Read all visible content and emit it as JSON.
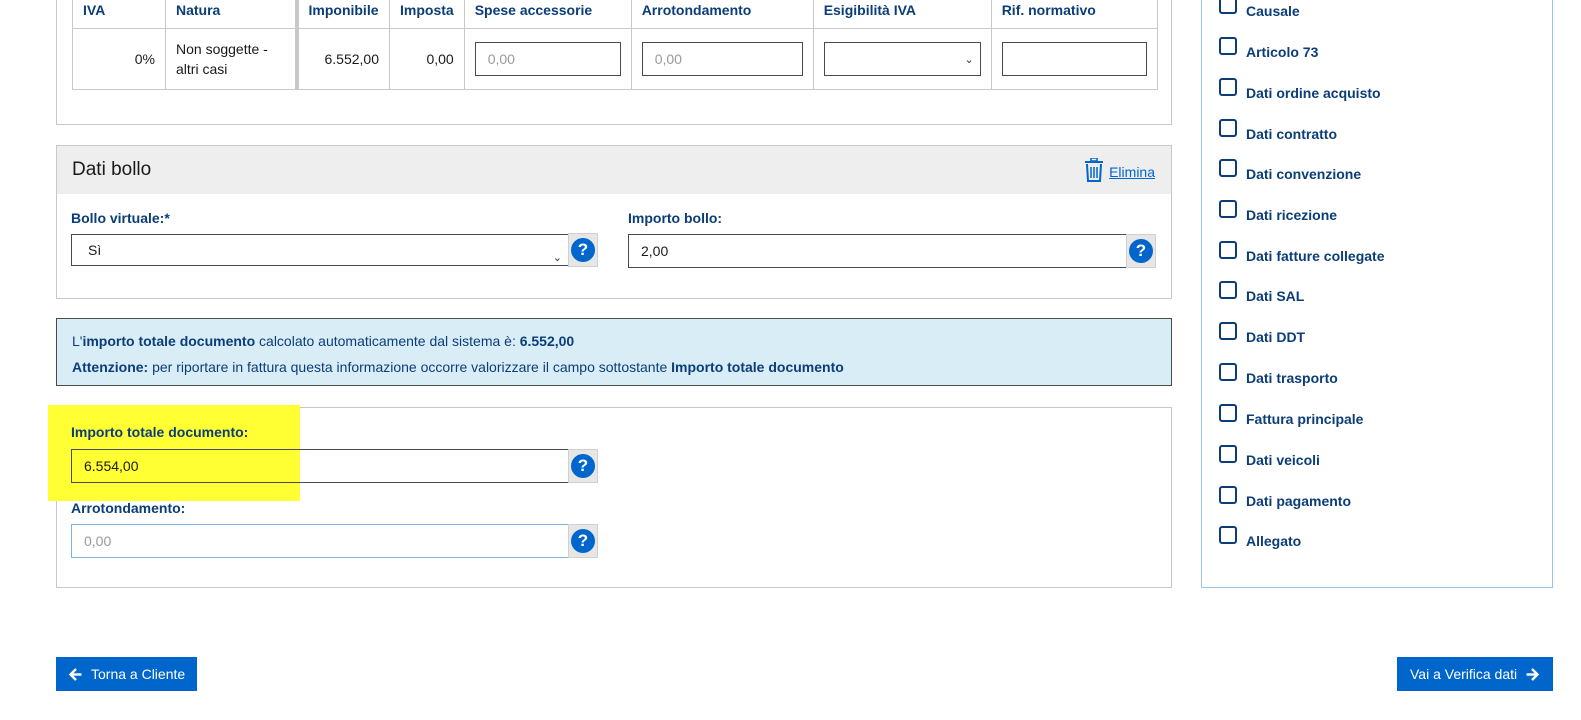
{
  "riepilogo": {
    "headers": [
      "IVA",
      "Natura",
      "Imponibile",
      "Imposta",
      "Spese accessorie",
      "Arrotondamento",
      "Esigibilità IVA",
      "Rif. normativo"
    ],
    "row": {
      "iva": "0%",
      "natura": "Non soggette - altri casi",
      "imponibile": "6.552,00",
      "imposta": "0,00",
      "spese_placeholder": "0,00",
      "arrotondamento_placeholder": "0,00",
      "esigibilita": "",
      "rif_normativo": ""
    }
  },
  "bollo": {
    "title": "Dati bollo",
    "delete_label": "Elimina",
    "virtuale_label": "Bollo virtuale:*",
    "virtuale_value": "Sì",
    "importo_label": "Importo bollo:",
    "importo_value": "2,00"
  },
  "info": {
    "line1_a": "L'",
    "line1_b": "importo totale documento",
    "line1_c": " calcolato automaticamente dal sistema è: ",
    "line1_d": "6.552,00",
    "line2_a": "Attenzione:",
    "line2_b": " per riportare in fattura questa informazione occorre valorizzare il campo sottostante ",
    "line2_c": "Importo totale documento"
  },
  "totale": {
    "label": "Importo totale documento:",
    "value": "6.554,00",
    "arrot_label": "Arrotondamento:",
    "arrot_placeholder": "0,00"
  },
  "sidebar": {
    "items": [
      {
        "label": "Causale"
      },
      {
        "label": "Articolo 73"
      },
      {
        "label": "Dati ordine acquisto"
      },
      {
        "label": "Dati contratto"
      },
      {
        "label": "Dati convenzione"
      },
      {
        "label": "Dati ricezione"
      },
      {
        "label": "Dati fatture collegate"
      },
      {
        "label": "Dati SAL"
      },
      {
        "label": "Dati DDT"
      },
      {
        "label": "Dati trasporto"
      },
      {
        "label": "Fattura principale"
      },
      {
        "label": "Dati veicoli"
      },
      {
        "label": "Dati pagamento"
      },
      {
        "label": "Allegato"
      }
    ]
  },
  "nav": {
    "back_label": "Torna a Cliente",
    "next_label": "Vai a Verifica dati"
  },
  "colors": {
    "accent": "#0066cc",
    "label": "#0b3d78",
    "highlight": "#ffff33",
    "info_bg": "#d9edf7"
  }
}
